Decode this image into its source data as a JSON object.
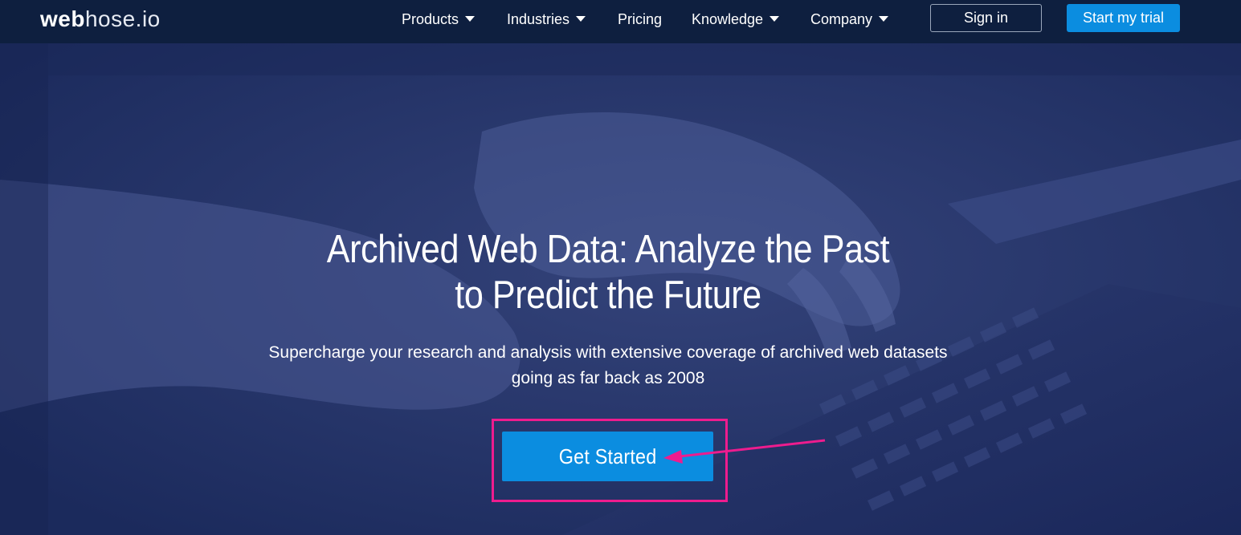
{
  "brand": {
    "logo_bold": "web",
    "logo_light": "hose.io"
  },
  "nav": {
    "items": [
      {
        "label": "Products",
        "dropdown": true
      },
      {
        "label": "Industries",
        "dropdown": true
      },
      {
        "label": "Pricing",
        "dropdown": false
      },
      {
        "label": "Knowledge",
        "dropdown": true
      },
      {
        "label": "Company",
        "dropdown": true
      }
    ],
    "signin_label": "Sign in",
    "trial_label": "Start my trial"
  },
  "hero": {
    "title_line1": "Archived Web Data: Analyze the Past",
    "title_line2": "to Predict the Future",
    "subtitle_line1": "Supercharge your research and analysis with extensive coverage of archived web datasets",
    "subtitle_line2": "going as far back as 2008",
    "cta_label": "Get Started"
  },
  "colors": {
    "nav_bg": "#0e1f3f",
    "hero_overlay": "#1f2f63",
    "accent_button": "#0b8de0",
    "annotation": "#ee1c8e"
  }
}
